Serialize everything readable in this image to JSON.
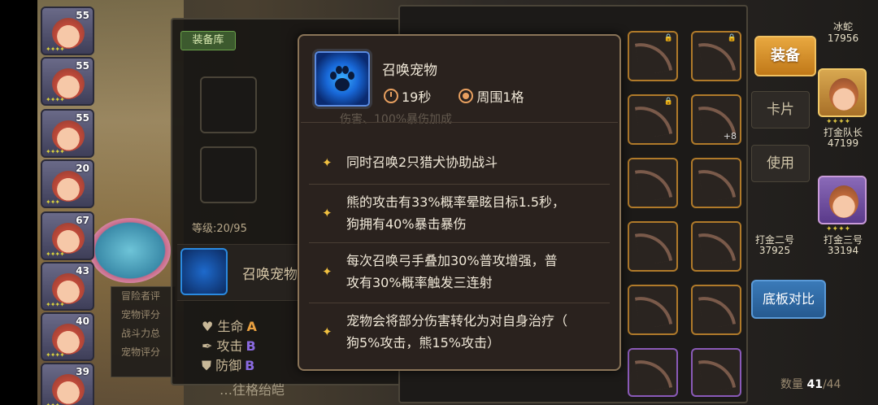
{
  "left_heroes": [
    {
      "level": "55"
    },
    {
      "level": "55"
    },
    {
      "level": "55"
    },
    {
      "level": "20"
    },
    {
      "level": "67"
    },
    {
      "level": "43"
    },
    {
      "level": "40"
    },
    {
      "level": "39"
    }
  ],
  "mid_panel": {
    "tab_label": "装备库",
    "level_text": "等级:20/95",
    "pet_name": "召唤宠物",
    "stats": [
      {
        "label": "生命",
        "grade": "A",
        "color": "#e8a040"
      },
      {
        "label": "攻击",
        "grade": "B",
        "color": "#8a6ae0"
      },
      {
        "label": "防御",
        "grade": "B",
        "color": "#8a6ae0"
      }
    ],
    "info_lines": [
      "冒险者评",
      "宠物评分",
      "战斗力总",
      "宠物评分"
    ],
    "bottom_hint": "…往格绐皑"
  },
  "tooltip": {
    "title": "召唤宠物",
    "duration": "19秒",
    "range": "周围1格",
    "cut_line": "伤害、100%暴伤加成",
    "lines": [
      "同时召唤2只猎犬协助战斗",
      "熊的攻击有33%概率晕眩目标1.5秒，",
      "狗拥有40%暴击暴伤",
      "每次召唤弓手叠加30%普攻增强，普",
      "攻有30%概率触发三连射",
      "宠物会将部分伤害转化为对自身治疗（",
      "狗5%攻击，熊15%攻击）"
    ]
  },
  "inventory": {
    "plus_badge": "+8",
    "count_label": "数量",
    "count_value": "41",
    "count_total": "/44"
  },
  "right": {
    "equip_button": "装备",
    "card_button": "卡片",
    "use_button": "使用",
    "compare_button": "底板对比",
    "characters": [
      {
        "name": "冰蛇",
        "power": "17956"
      },
      {
        "name": "打金队长",
        "power": "47199"
      },
      {
        "name": "打金二号",
        "power": "37925"
      },
      {
        "name": "打金三号",
        "power": "33194"
      }
    ]
  }
}
